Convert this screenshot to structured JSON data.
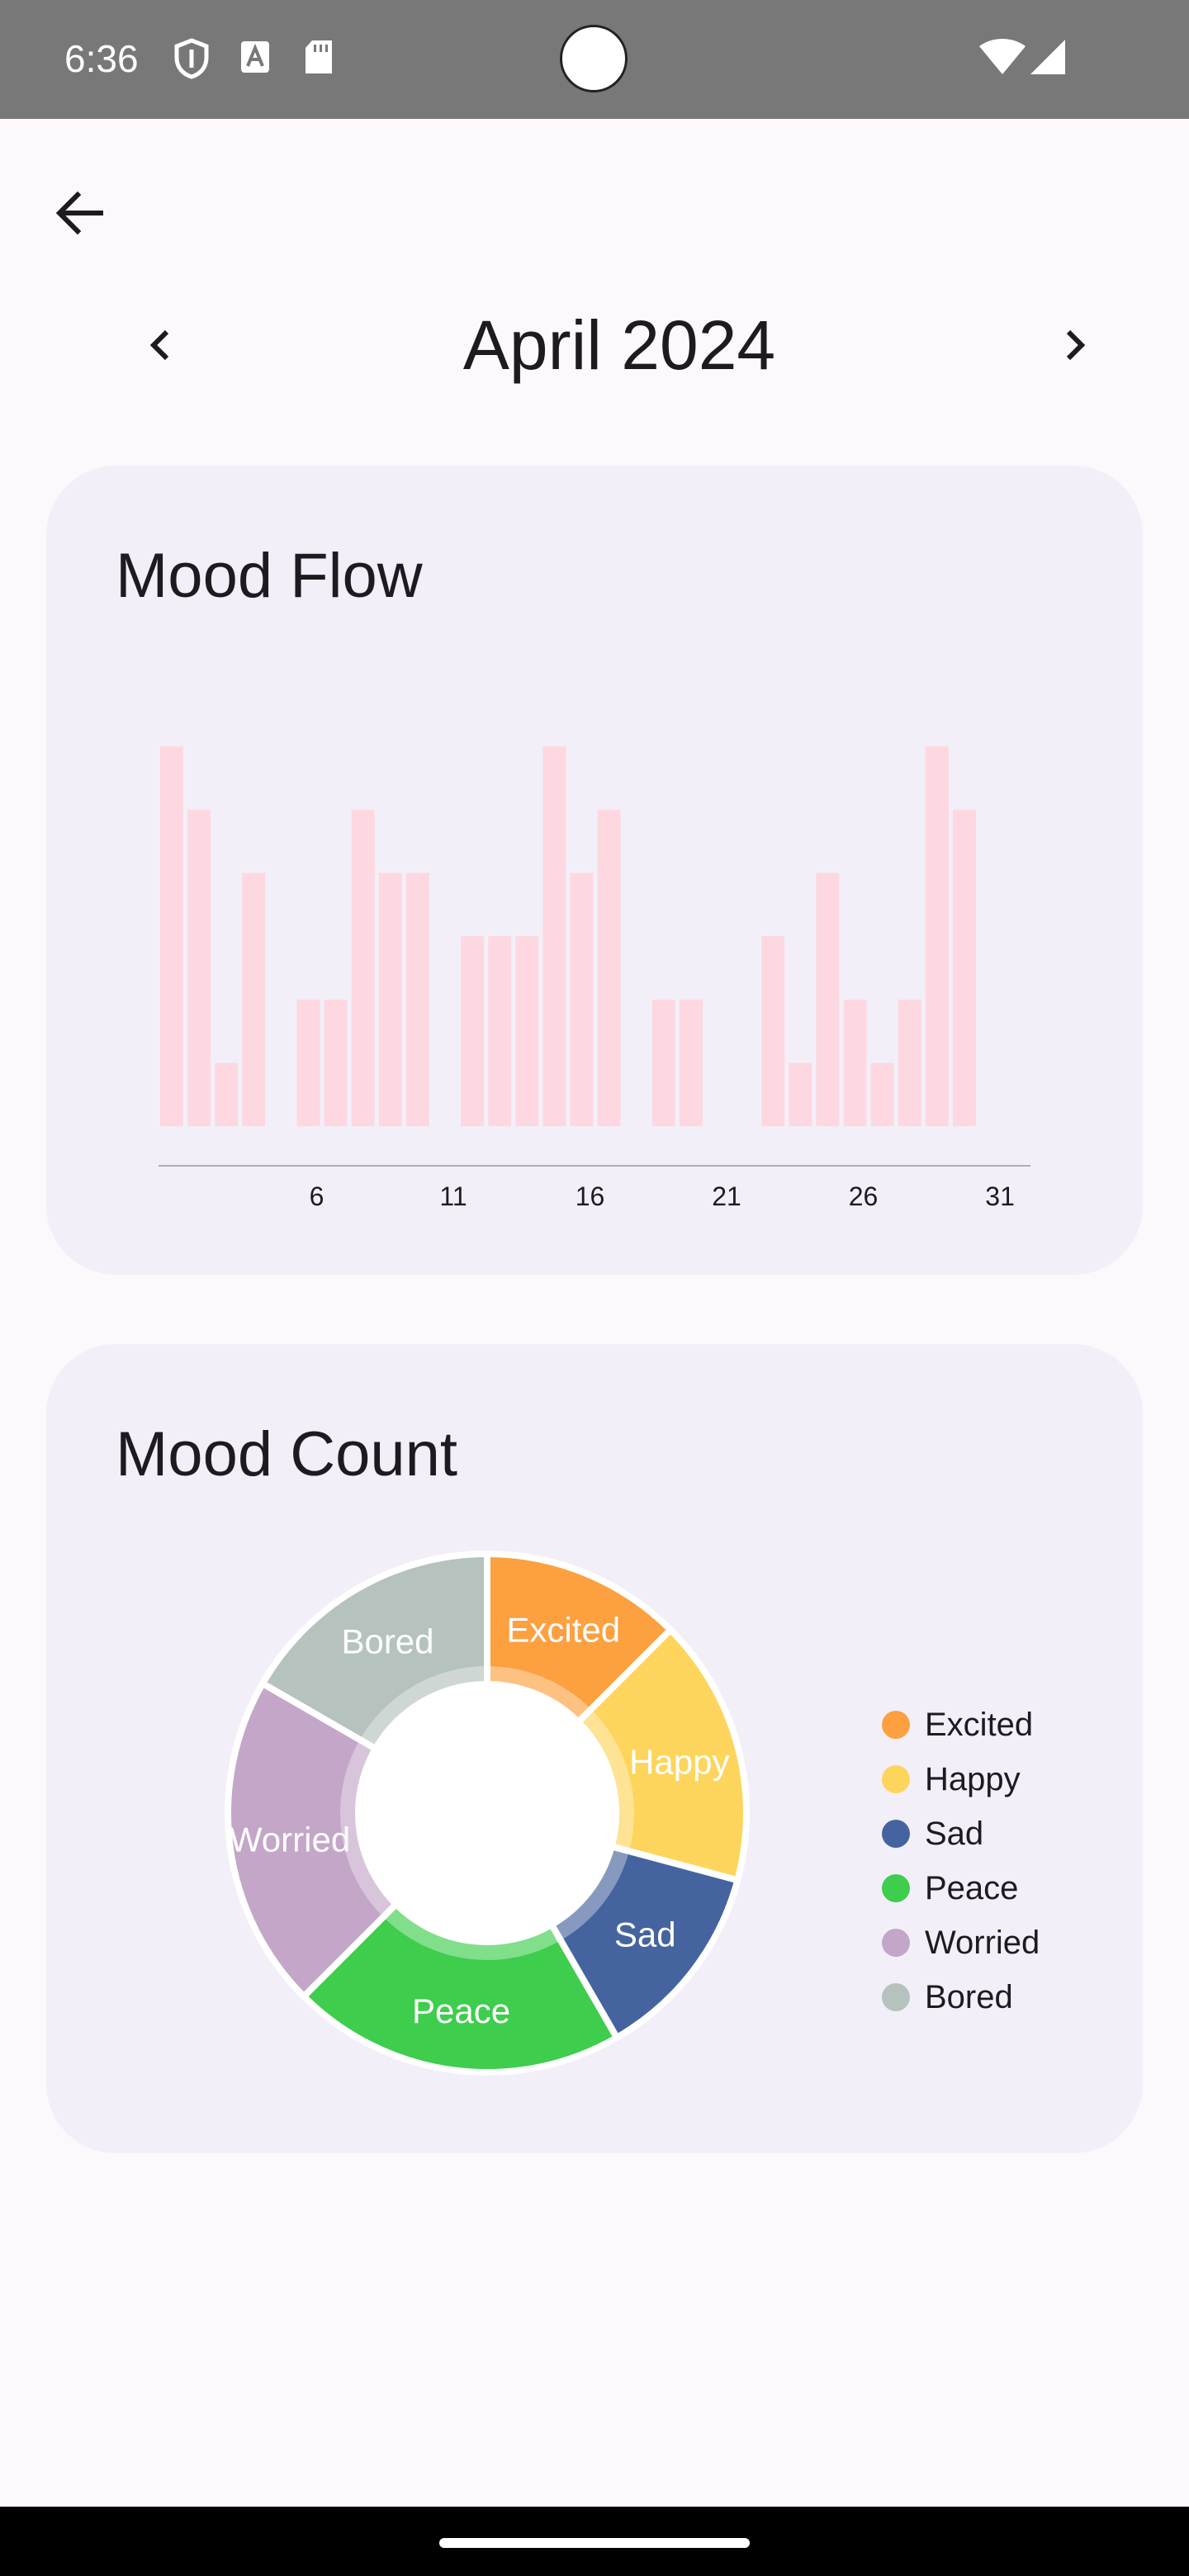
{
  "status_bar": {
    "time": "6:36",
    "icons": [
      "shield-icon",
      "a-box-icon",
      "sd-card-icon",
      "wifi-icon",
      "signal-icon"
    ]
  },
  "header": {
    "back_icon": "arrow-back-icon",
    "month_label": "April 2024",
    "prev_icon": "chevron-left-icon",
    "next_icon": "chevron-right-icon"
  },
  "mood_flow": {
    "title": "Mood Flow"
  },
  "mood_count": {
    "title": "Mood Count"
  },
  "colors": {
    "bar": "#fdd8e0",
    "axis": "#b0adb8",
    "card": "#f2eff8",
    "background": "#fdf8fc"
  },
  "chart_data": [
    {
      "type": "bar",
      "title": "Mood Flow",
      "x": [
        1,
        2,
        3,
        4,
        6,
        7,
        8,
        9,
        10,
        12,
        13,
        14,
        15,
        16,
        17,
        19,
        20,
        23,
        24,
        25,
        26,
        27,
        28,
        29,
        30
      ],
      "values": [
        6,
        5,
        1,
        4,
        2,
        2,
        5,
        4,
        4,
        3,
        3,
        3,
        6,
        4,
        5,
        2,
        2,
        3,
        1,
        4,
        2,
        1,
        2,
        6,
        5
      ],
      "xlim": [
        1,
        31
      ],
      "xticks": [
        6,
        11,
        16,
        21,
        26,
        31
      ],
      "ylim": [
        0,
        6
      ],
      "grid": false
    },
    {
      "type": "pie",
      "title": "Mood Count",
      "categories": [
        "Excited",
        "Happy",
        "Sad",
        "Peace",
        "Worried",
        "Bored"
      ],
      "values": [
        3,
        4,
        3,
        5,
        5,
        4
      ],
      "colors": [
        "#fca040",
        "#fed55c",
        "#45649f",
        "#3ecd4d",
        "#c3a6c8",
        "#b6c2be"
      ],
      "legend": "right",
      "donut": true
    }
  ]
}
